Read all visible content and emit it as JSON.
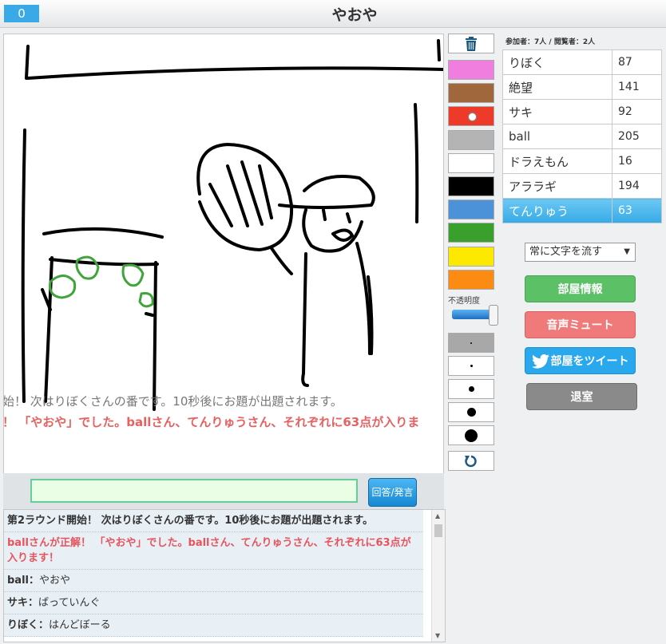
{
  "header": {
    "counter": "0",
    "room_title": "やおや"
  },
  "canvas_overlay": {
    "line1": "始！ 次はりぼくさんの番です。10秒後にお題が出題されます。",
    "line2": "！ 「やおや」でした。ballさん、てんりゅうさん、それぞれに63点が入りま"
  },
  "tools": {
    "colors": [
      "#f07ede",
      "#a0663c",
      "#ee3a28",
      "#b4b4b4",
      "#ffffff",
      "#000000",
      "#4c92d8",
      "#3aa02c",
      "#fde800",
      "#fc8b14"
    ],
    "opacity_label": "不透明度",
    "opacity_level": 0.95,
    "brush_sizes": [
      2,
      3,
      7,
      11,
      16
    ]
  },
  "chat": {
    "input_value": "",
    "answer_label": "回答/発言"
  },
  "log": [
    {
      "type": "sys",
      "text": "第2ラウンド開始！ 次はりぼくさんの番です。10秒後にお題が出題されます。"
    },
    {
      "type": "correct",
      "text": "ballさんが正解！ 「やおや」でした。ballさん、てんりゅうさん、それぞれに63点が入ります！"
    },
    {
      "type": "msg",
      "who": "ball",
      "sep": "：",
      "text": "やおや"
    },
    {
      "type": "msg",
      "who": "サキ",
      "sep": "：",
      "text": "ばっていんぐ"
    },
    {
      "type": "msg",
      "who": "りぼく",
      "sep": "：",
      "text": "はんどぼーる"
    }
  ],
  "room": {
    "counts": "参加者：7人 / 閲覧者：2人",
    "players": [
      {
        "name": "りぼく",
        "score": "87"
      },
      {
        "name": "絶望",
        "score": "141"
      },
      {
        "name": "サキ",
        "score": "92"
      },
      {
        "name": "ball",
        "score": "205"
      },
      {
        "name": "ドラえもん",
        "score": "16"
      },
      {
        "name": "アララギ",
        "score": "194"
      },
      {
        "name": "てんりゅう",
        "score": "63"
      }
    ],
    "active_player_index": 6,
    "flow_select": "常に文字を流す",
    "room_info_label": "部屋情報",
    "mute_label": "音声ミュート",
    "tweet_label": "部屋をツイート",
    "exit_label": "退室"
  }
}
